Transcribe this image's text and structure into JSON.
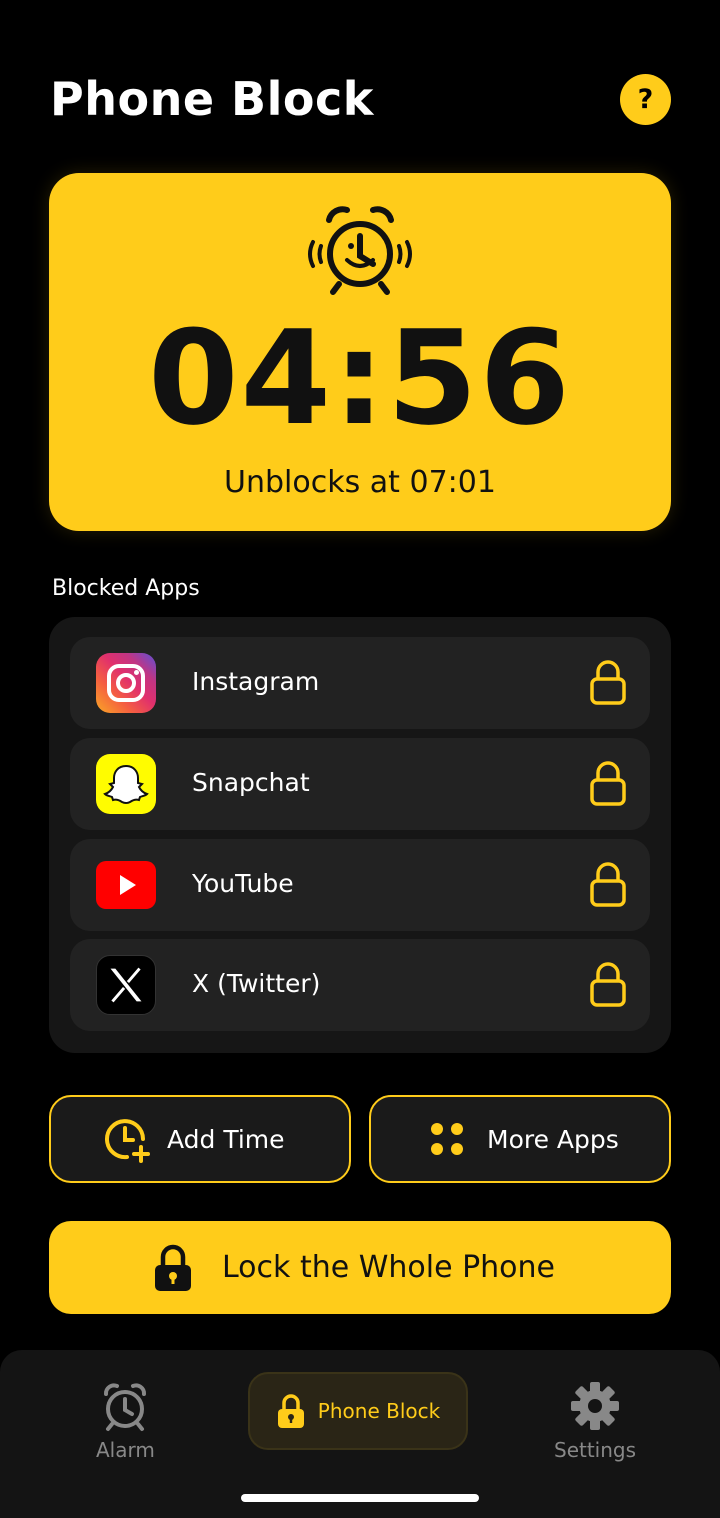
{
  "header": {
    "title": "Phone Block",
    "help_label": "?"
  },
  "timer": {
    "remaining": "04:56",
    "unblock_prefix": "Unblocks at",
    "unblock_time": "07:01"
  },
  "blocked_apps": {
    "label": "Blocked Apps",
    "items": [
      {
        "name": "Instagram",
        "icon": "instagram-icon",
        "locked": true
      },
      {
        "name": "Snapchat",
        "icon": "snapchat-icon",
        "locked": true
      },
      {
        "name": "YouTube",
        "icon": "youtube-icon",
        "locked": true
      },
      {
        "name": "X (Twitter)",
        "icon": "x-twitter-icon",
        "locked": true
      }
    ]
  },
  "actions": {
    "add_time": "Add Time",
    "more_apps": "More Apps",
    "lock_phone": "Lock the Whole Phone"
  },
  "nav": {
    "alarm": "Alarm",
    "phone_block": "Phone Block",
    "settings": "Settings",
    "active": "phone_block"
  },
  "colors": {
    "accent": "#FFCC1A",
    "background": "#000000",
    "panel": "#161616",
    "row": "#222222"
  }
}
